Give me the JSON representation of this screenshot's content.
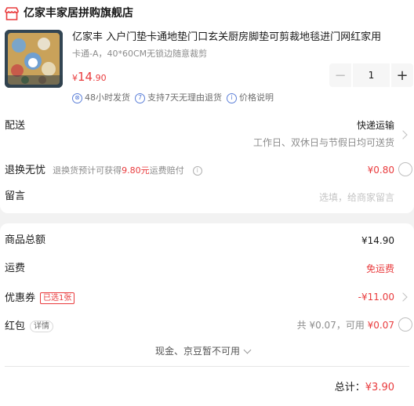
{
  "store": {
    "name": "亿家丰家居拼购旗舰店"
  },
  "product": {
    "title": "亿家丰 入户门垫卡通地垫门口玄关厨房脚垫可剪裁地毯进门网红家用",
    "spec": "卡通-A，40*60CM无锁边随意裁剪",
    "price_symbol": "¥",
    "price_int": "14",
    "price_dec": ".90",
    "quantity": "1",
    "minus_label": "−",
    "plus_label": "+",
    "services": [
      {
        "icon": "⊗",
        "text": "48小时发货"
      },
      {
        "icon": "7",
        "text": "支持7天无理由退货"
      },
      {
        "icon": "i",
        "text": "价格说明"
      }
    ]
  },
  "delivery": {
    "label": "配送",
    "method": "快递运输",
    "note": "工作日、双休日与节假日均可送货"
  },
  "return_worry": {
    "label": "退换无忧",
    "desc_prefix": "退换货预计可获得",
    "desc_amount": "9.80元",
    "desc_suffix": "运费赔付",
    "price": "¥0.80"
  },
  "message": {
    "label": "留言",
    "placeholder": "选填，给商家留言"
  },
  "summary": {
    "goods_total_label": "商品总额",
    "goods_total": "¥14.90",
    "shipping_label": "运费",
    "shipping": "免运费",
    "coupon_label": "优惠券",
    "coupon_tag": "已选1张",
    "coupon_value": "-¥11.00",
    "redpacket_label": "红包",
    "redpacket_tag": "详情",
    "redpacket_total_prefix": "共 ¥0.07，可用 ",
    "redpacket_available": "¥0.07",
    "cash_note": "现金、京豆暂不可用",
    "total_label": "总计：",
    "total": "¥3.90"
  },
  "colors": {
    "accent": "#e93b3d",
    "service_blue": "#5b7fd8",
    "background": "#f2f2f2"
  }
}
